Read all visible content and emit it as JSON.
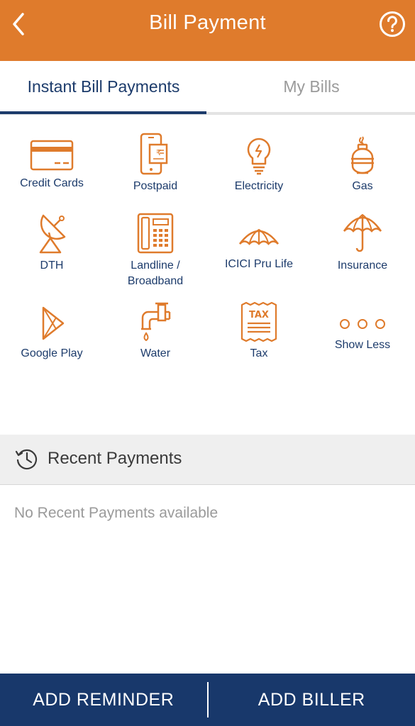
{
  "header": {
    "title": "Bill Payment"
  },
  "tabs": [
    {
      "label": "Instant Bill Payments"
    },
    {
      "label": "My Bills"
    }
  ],
  "billers": [
    {
      "label": "Credit Cards"
    },
    {
      "label": "Postpaid"
    },
    {
      "label": "Electricity"
    },
    {
      "label": "Gas"
    },
    {
      "label": "DTH"
    },
    {
      "label": "Landline /\nBroadband"
    },
    {
      "label": "ICICI Pru Life"
    },
    {
      "label": "Insurance"
    },
    {
      "label": "Google Play"
    },
    {
      "label": "Water"
    },
    {
      "label": "Tax"
    },
    {
      "label": "Show Less"
    }
  ],
  "tax_icon_text": "TAX",
  "postpaid_icon_text": "₹",
  "recent": {
    "title": "Recent Payments",
    "empty_message": "No Recent Payments available"
  },
  "footer": {
    "add_reminder": "ADD REMINDER",
    "add_biller": "ADD BILLER"
  },
  "colors": {
    "accent": "#df7b2c",
    "navy": "#1c3b6b",
    "footer": "#18386b"
  }
}
